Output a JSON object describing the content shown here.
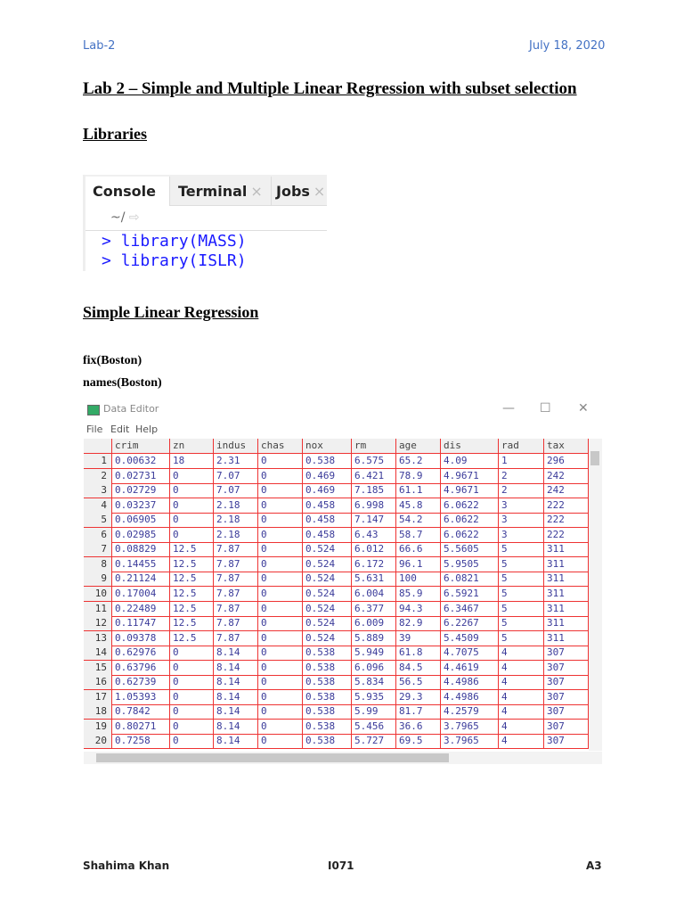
{
  "header": {
    "left": "Lab-2",
    "right": "July 18, 2020"
  },
  "title": "Lab 2 – Simple and Multiple Linear Regression with subset selection",
  "sections": {
    "libraries": "Libraries",
    "simple": "Simple Linear Regression"
  },
  "console": {
    "tabs": [
      "Console",
      "Terminal",
      "Jobs"
    ],
    "close": "×",
    "path": "~/",
    "arrow": "⇨",
    "lines": [
      "> library(MASS)",
      "> library(ISLR)"
    ]
  },
  "code": [
    "fix(Boston)",
    "names(Boston)"
  ],
  "editor": {
    "title": "Data Editor",
    "controls": [
      "—",
      "☐",
      "✕"
    ],
    "menu": [
      "File",
      "Edit",
      "Help"
    ],
    "columns": [
      "crim",
      "zn",
      "indus",
      "chas",
      "nox",
      "rm",
      "age",
      "dis",
      "rad",
      "tax"
    ],
    "rows": [
      [
        "0.00632",
        "18",
        "2.31",
        "0",
        "0.538",
        "6.575",
        "65.2",
        "4.09",
        "1",
        "296"
      ],
      [
        "0.02731",
        "0",
        "7.07",
        "0",
        "0.469",
        "6.421",
        "78.9",
        "4.9671",
        "2",
        "242"
      ],
      [
        "0.02729",
        "0",
        "7.07",
        "0",
        "0.469",
        "7.185",
        "61.1",
        "4.9671",
        "2",
        "242"
      ],
      [
        "0.03237",
        "0",
        "2.18",
        "0",
        "0.458",
        "6.998",
        "45.8",
        "6.0622",
        "3",
        "222"
      ],
      [
        "0.06905",
        "0",
        "2.18",
        "0",
        "0.458",
        "7.147",
        "54.2",
        "6.0622",
        "3",
        "222"
      ],
      [
        "0.02985",
        "0",
        "2.18",
        "0",
        "0.458",
        "6.43",
        "58.7",
        "6.0622",
        "3",
        "222"
      ],
      [
        "0.08829",
        "12.5",
        "7.87",
        "0",
        "0.524",
        "6.012",
        "66.6",
        "5.5605",
        "5",
        "311"
      ],
      [
        "0.14455",
        "12.5",
        "7.87",
        "0",
        "0.524",
        "6.172",
        "96.1",
        "5.9505",
        "5",
        "311"
      ],
      [
        "0.21124",
        "12.5",
        "7.87",
        "0",
        "0.524",
        "5.631",
        "100",
        "6.0821",
        "5",
        "311"
      ],
      [
        "0.17004",
        "12.5",
        "7.87",
        "0",
        "0.524",
        "6.004",
        "85.9",
        "6.5921",
        "5",
        "311"
      ],
      [
        "0.22489",
        "12.5",
        "7.87",
        "0",
        "0.524",
        "6.377",
        "94.3",
        "6.3467",
        "5",
        "311"
      ],
      [
        "0.11747",
        "12.5",
        "7.87",
        "0",
        "0.524",
        "6.009",
        "82.9",
        "6.2267",
        "5",
        "311"
      ],
      [
        "0.09378",
        "12.5",
        "7.87",
        "0",
        "0.524",
        "5.889",
        "39",
        "5.4509",
        "5",
        "311"
      ],
      [
        "0.62976",
        "0",
        "8.14",
        "0",
        "0.538",
        "5.949",
        "61.8",
        "4.7075",
        "4",
        "307"
      ],
      [
        "0.63796",
        "0",
        "8.14",
        "0",
        "0.538",
        "6.096",
        "84.5",
        "4.4619",
        "4",
        "307"
      ],
      [
        "0.62739",
        "0",
        "8.14",
        "0",
        "0.538",
        "5.834",
        "56.5",
        "4.4986",
        "4",
        "307"
      ],
      [
        "1.05393",
        "0",
        "8.14",
        "0",
        "0.538",
        "5.935",
        "29.3",
        "4.4986",
        "4",
        "307"
      ],
      [
        "0.7842",
        "0",
        "8.14",
        "0",
        "0.538",
        "5.99",
        "81.7",
        "4.2579",
        "4",
        "307"
      ],
      [
        "0.80271",
        "0",
        "8.14",
        "0",
        "0.538",
        "5.456",
        "36.6",
        "3.7965",
        "4",
        "307"
      ],
      [
        "0.7258",
        "0",
        "8.14",
        "0",
        "0.538",
        "5.727",
        "69.5",
        "3.7965",
        "4",
        "307"
      ]
    ]
  },
  "footer": {
    "left": "Shahima Khan",
    "center": "I071",
    "right": "A3"
  }
}
